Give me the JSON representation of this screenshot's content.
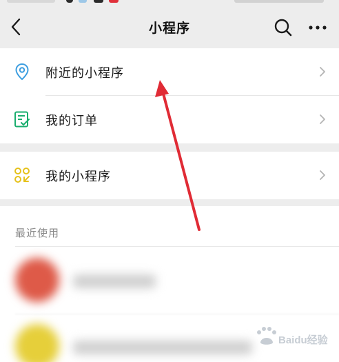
{
  "nav": {
    "title": "小程序",
    "back_icon": "chevron-left-icon",
    "search_icon": "search-icon",
    "more_icon": "more-horizontal-icon"
  },
  "menu": {
    "items": [
      {
        "label": "附近的小程序",
        "icon": "location-pin-icon",
        "icon_color": "#3d9ee0"
      },
      {
        "label": "我的订单",
        "icon": "order-list-icon",
        "icon_color": "#1aad6e"
      },
      {
        "label": "我的小程序",
        "icon": "mini-program-grid-icon",
        "icon_color": "#e6c21c"
      }
    ]
  },
  "recent": {
    "title": "最近使用",
    "items_blurred": true
  },
  "annotation": {
    "type": "red-arrow",
    "color": "#e02b35"
  },
  "watermark": {
    "text": "Baidu经验"
  },
  "colors": {
    "background_gray": "#ededed",
    "chevron": "#b4b4b4",
    "secondary_text": "#8a8a8a"
  }
}
